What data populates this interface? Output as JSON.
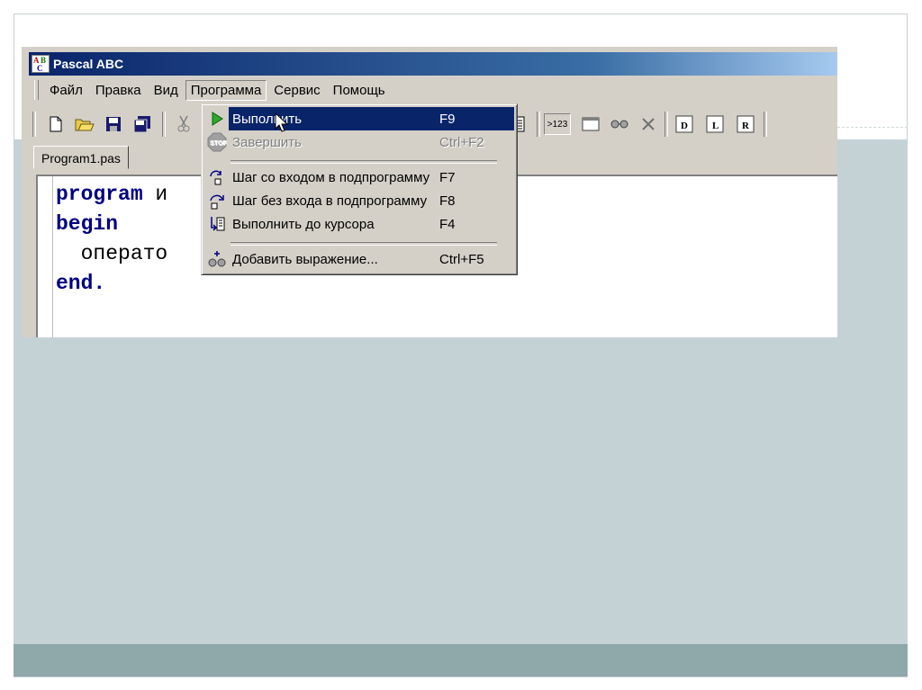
{
  "window": {
    "title": "Pascal ABC"
  },
  "menubar": {
    "items": [
      "Файл",
      "Правка",
      "Вид",
      "Программа",
      "Сервис",
      "Помощь"
    ]
  },
  "toolbar": {
    "counter_label": ">123"
  },
  "tabs": [
    {
      "label": "Program1.pas"
    }
  ],
  "editor": {
    "lines": [
      {
        "keyword": "program",
        "rest": " и"
      },
      {
        "keyword": "begin",
        "rest": ""
      },
      {
        "keyword": "",
        "rest": "  операто"
      },
      {
        "keyword": "end.",
        "rest": ""
      }
    ]
  },
  "dropdown": {
    "items": [
      {
        "label": "Выполнить",
        "shortcut": "F9",
        "icon": "run-icon",
        "highlighted": true,
        "disabled": false
      },
      {
        "label": "Завершить",
        "shortcut": "Ctrl+F2",
        "icon": "stop-icon",
        "highlighted": false,
        "disabled": true
      },
      {
        "label": "Шаг со входом в подпрограмму",
        "shortcut": "F7",
        "icon": "step-into-icon",
        "highlighted": false,
        "disabled": false
      },
      {
        "label": "Шаг без входа в подпрограмму",
        "shortcut": "F8",
        "icon": "step-over-icon",
        "highlighted": false,
        "disabled": false
      },
      {
        "label": "Выполнить до курсора",
        "shortcut": "F4",
        "icon": "run-to-cursor-icon",
        "highlighted": false,
        "disabled": false
      },
      {
        "label": "Добавить выражение...",
        "shortcut": "Ctrl+F5",
        "icon": "add-watch-icon",
        "highlighted": false,
        "disabled": false
      }
    ]
  },
  "colors": {
    "highlight": "#0a246a",
    "keyword": "#000080",
    "slide_band": "#c4d2d6",
    "slide_footer": "#8fa8a9"
  }
}
